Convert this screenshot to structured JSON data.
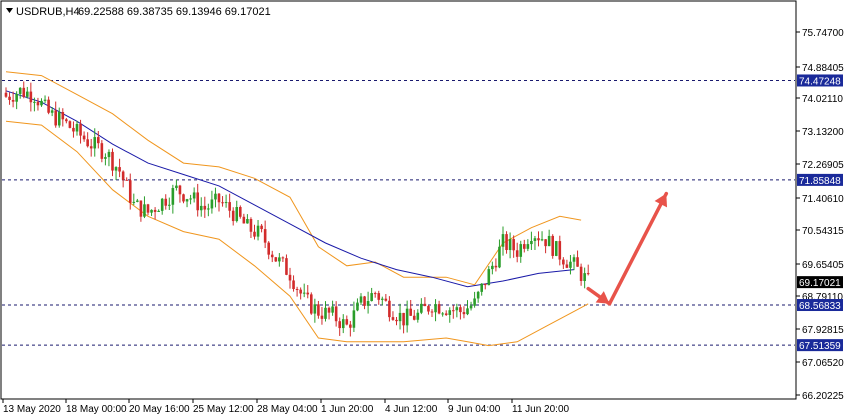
{
  "header": {
    "symbol": "USDRUB,H4",
    "ohlc": "69.22588 69.38735 69.13946 69.17021"
  },
  "chart_data": {
    "type": "candlestick",
    "title": "USDRUB,H4",
    "ylim": [
      66.2,
      76.3
    ],
    "y_ticks": [
      "75.74700",
      "74.88405",
      "74.02110",
      "73.13200",
      "72.26905",
      "71.40610",
      "70.54315",
      "69.65405",
      "68.79110",
      "67.92815",
      "67.06520",
      "66.20225"
    ],
    "x_ticks": [
      "13 May 2020",
      "18 May 00:00",
      "20 May 16:00",
      "25 May 12:00",
      "28 May 04:00",
      "1 Jun 20:00",
      "4 Jun 12:00",
      "9 Jun 04:00",
      "11 Jun 20:00"
    ],
    "levels": [
      {
        "label": "74.47248",
        "value": 74.47248
      },
      {
        "label": "71.85848",
        "value": 71.85848
      },
      {
        "label": "68.56833",
        "value": 68.56833
      },
      {
        "label": "67.51359",
        "value": 67.51359
      }
    ],
    "current_price": {
      "label": "69.17021",
      "value": 69.17021
    },
    "close_path": [
      [
        0,
        74.05
      ],
      [
        4,
        74.2
      ],
      [
        8,
        74.1
      ],
      [
        12,
        73.6
      ],
      [
        16,
        73.4
      ],
      [
        20,
        73.1
      ],
      [
        24,
        72.8
      ],
      [
        28,
        72.6
      ],
      [
        32,
        72.1
      ],
      [
        36,
        71.2
      ],
      [
        40,
        71.0
      ],
      [
        44,
        71.3
      ],
      [
        48,
        71.6
      ],
      [
        52,
        71.4
      ],
      [
        56,
        71.1
      ],
      [
        60,
        71.3
      ],
      [
        64,
        71.0
      ],
      [
        68,
        70.6
      ],
      [
        72,
        70.4
      ],
      [
        76,
        69.8
      ],
      [
        80,
        69.4
      ],
      [
        84,
        68.7
      ],
      [
        88,
        68.4
      ],
      [
        92,
        68.3
      ],
      [
        96,
        68.0
      ],
      [
        100,
        68.6
      ],
      [
        104,
        68.9
      ],
      [
        108,
        68.5
      ],
      [
        112,
        68.2
      ],
      [
        116,
        68.3
      ],
      [
        120,
        68.6
      ],
      [
        124,
        68.5
      ],
      [
        128,
        68.4
      ],
      [
        132,
        68.6
      ],
      [
        136,
        69.4
      ],
      [
        140,
        70.2
      ],
      [
        144,
        70.0
      ],
      [
        148,
        70.5
      ],
      [
        152,
        70.3
      ],
      [
        156,
        69.9
      ],
      [
        160,
        69.6
      ],
      [
        164,
        69.17
      ]
    ],
    "ma_path": [
      [
        0,
        74.2
      ],
      [
        10,
        73.9
      ],
      [
        20,
        73.4
      ],
      [
        30,
        72.8
      ],
      [
        40,
        72.3
      ],
      [
        50,
        72.0
      ],
      [
        60,
        71.7
      ],
      [
        70,
        71.2
      ],
      [
        80,
        70.7
      ],
      [
        90,
        70.2
      ],
      [
        100,
        69.8
      ],
      [
        110,
        69.5
      ],
      [
        120,
        69.3
      ],
      [
        130,
        69.05
      ],
      [
        140,
        69.2
      ],
      [
        150,
        69.4
      ],
      [
        160,
        69.5
      ]
    ],
    "upper_band": [
      [
        0,
        74.7
      ],
      [
        10,
        74.6
      ],
      [
        20,
        74.1
      ],
      [
        30,
        73.6
      ],
      [
        40,
        72.9
      ],
      [
        50,
        72.3
      ],
      [
        60,
        72.2
      ],
      [
        70,
        71.9
      ],
      [
        80,
        71.4
      ],
      [
        88,
        70.1
      ],
      [
        96,
        69.6
      ],
      [
        104,
        69.7
      ],
      [
        112,
        69.3
      ],
      [
        124,
        69.3
      ],
      [
        132,
        69.1
      ],
      [
        140,
        70.2
      ],
      [
        148,
        70.6
      ],
      [
        156,
        70.9
      ],
      [
        162,
        70.8
      ]
    ],
    "lower_band": [
      [
        0,
        73.4
      ],
      [
        10,
        73.3
      ],
      [
        20,
        72.6
      ],
      [
        30,
        71.6
      ],
      [
        40,
        70.9
      ],
      [
        50,
        70.5
      ],
      [
        60,
        70.3
      ],
      [
        70,
        69.6
      ],
      [
        80,
        68.8
      ],
      [
        88,
        67.7
      ],
      [
        96,
        67.6
      ],
      [
        104,
        67.6
      ],
      [
        112,
        67.6
      ],
      [
        124,
        67.7
      ],
      [
        130,
        67.6
      ],
      [
        136,
        67.5
      ],
      [
        144,
        67.6
      ],
      [
        152,
        68.0
      ],
      [
        160,
        68.4
      ],
      [
        164,
        68.6
      ]
    ],
    "forecast_arrows": [
      {
        "from": [
          164,
          69.0
        ],
        "to": [
          170,
          68.6
        ]
      },
      {
        "from": [
          170,
          68.6
        ],
        "to": [
          186,
          71.5
        ]
      }
    ],
    "colors": {
      "bull": "#2a9d2a",
      "bear": "#d22b2b",
      "ma": "#1a1aa8",
      "band": "#f0961e",
      "level": "#1a1a6e",
      "tag_bg": "#1a2a9a",
      "price_tag_bg": "#000000",
      "arrow": "#e8534a"
    }
  }
}
